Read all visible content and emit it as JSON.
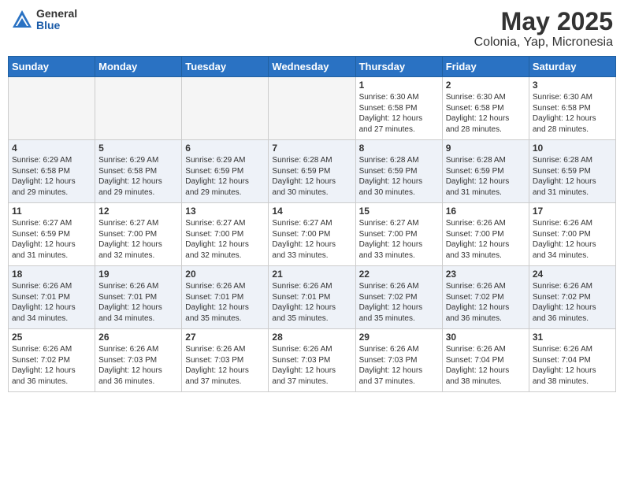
{
  "header": {
    "logo_general": "General",
    "logo_blue": "Blue",
    "month_year": "May 2025",
    "location": "Colonia, Yap, Micronesia"
  },
  "days_of_week": [
    "Sunday",
    "Monday",
    "Tuesday",
    "Wednesday",
    "Thursday",
    "Friday",
    "Saturday"
  ],
  "weeks": [
    [
      {
        "day": "",
        "info": ""
      },
      {
        "day": "",
        "info": ""
      },
      {
        "day": "",
        "info": ""
      },
      {
        "day": "",
        "info": ""
      },
      {
        "day": "1",
        "info": "Sunrise: 6:30 AM\nSunset: 6:58 PM\nDaylight: 12 hours\nand 27 minutes."
      },
      {
        "day": "2",
        "info": "Sunrise: 6:30 AM\nSunset: 6:58 PM\nDaylight: 12 hours\nand 28 minutes."
      },
      {
        "day": "3",
        "info": "Sunrise: 6:30 AM\nSunset: 6:58 PM\nDaylight: 12 hours\nand 28 minutes."
      }
    ],
    [
      {
        "day": "4",
        "info": "Sunrise: 6:29 AM\nSunset: 6:58 PM\nDaylight: 12 hours\nand 29 minutes."
      },
      {
        "day": "5",
        "info": "Sunrise: 6:29 AM\nSunset: 6:58 PM\nDaylight: 12 hours\nand 29 minutes."
      },
      {
        "day": "6",
        "info": "Sunrise: 6:29 AM\nSunset: 6:59 PM\nDaylight: 12 hours\nand 29 minutes."
      },
      {
        "day": "7",
        "info": "Sunrise: 6:28 AM\nSunset: 6:59 PM\nDaylight: 12 hours\nand 30 minutes."
      },
      {
        "day": "8",
        "info": "Sunrise: 6:28 AM\nSunset: 6:59 PM\nDaylight: 12 hours\nand 30 minutes."
      },
      {
        "day": "9",
        "info": "Sunrise: 6:28 AM\nSunset: 6:59 PM\nDaylight: 12 hours\nand 31 minutes."
      },
      {
        "day": "10",
        "info": "Sunrise: 6:28 AM\nSunset: 6:59 PM\nDaylight: 12 hours\nand 31 minutes."
      }
    ],
    [
      {
        "day": "11",
        "info": "Sunrise: 6:27 AM\nSunset: 6:59 PM\nDaylight: 12 hours\nand 31 minutes."
      },
      {
        "day": "12",
        "info": "Sunrise: 6:27 AM\nSunset: 7:00 PM\nDaylight: 12 hours\nand 32 minutes."
      },
      {
        "day": "13",
        "info": "Sunrise: 6:27 AM\nSunset: 7:00 PM\nDaylight: 12 hours\nand 32 minutes."
      },
      {
        "day": "14",
        "info": "Sunrise: 6:27 AM\nSunset: 7:00 PM\nDaylight: 12 hours\nand 33 minutes."
      },
      {
        "day": "15",
        "info": "Sunrise: 6:27 AM\nSunset: 7:00 PM\nDaylight: 12 hours\nand 33 minutes."
      },
      {
        "day": "16",
        "info": "Sunrise: 6:26 AM\nSunset: 7:00 PM\nDaylight: 12 hours\nand 33 minutes."
      },
      {
        "day": "17",
        "info": "Sunrise: 6:26 AM\nSunset: 7:00 PM\nDaylight: 12 hours\nand 34 minutes."
      }
    ],
    [
      {
        "day": "18",
        "info": "Sunrise: 6:26 AM\nSunset: 7:01 PM\nDaylight: 12 hours\nand 34 minutes."
      },
      {
        "day": "19",
        "info": "Sunrise: 6:26 AM\nSunset: 7:01 PM\nDaylight: 12 hours\nand 34 minutes."
      },
      {
        "day": "20",
        "info": "Sunrise: 6:26 AM\nSunset: 7:01 PM\nDaylight: 12 hours\nand 35 minutes."
      },
      {
        "day": "21",
        "info": "Sunrise: 6:26 AM\nSunset: 7:01 PM\nDaylight: 12 hours\nand 35 minutes."
      },
      {
        "day": "22",
        "info": "Sunrise: 6:26 AM\nSunset: 7:02 PM\nDaylight: 12 hours\nand 35 minutes."
      },
      {
        "day": "23",
        "info": "Sunrise: 6:26 AM\nSunset: 7:02 PM\nDaylight: 12 hours\nand 36 minutes."
      },
      {
        "day": "24",
        "info": "Sunrise: 6:26 AM\nSunset: 7:02 PM\nDaylight: 12 hours\nand 36 minutes."
      }
    ],
    [
      {
        "day": "25",
        "info": "Sunrise: 6:26 AM\nSunset: 7:02 PM\nDaylight: 12 hours\nand 36 minutes."
      },
      {
        "day": "26",
        "info": "Sunrise: 6:26 AM\nSunset: 7:03 PM\nDaylight: 12 hours\nand 36 minutes."
      },
      {
        "day": "27",
        "info": "Sunrise: 6:26 AM\nSunset: 7:03 PM\nDaylight: 12 hours\nand 37 minutes."
      },
      {
        "day": "28",
        "info": "Sunrise: 6:26 AM\nSunset: 7:03 PM\nDaylight: 12 hours\nand 37 minutes."
      },
      {
        "day": "29",
        "info": "Sunrise: 6:26 AM\nSunset: 7:03 PM\nDaylight: 12 hours\nand 37 minutes."
      },
      {
        "day": "30",
        "info": "Sunrise: 6:26 AM\nSunset: 7:04 PM\nDaylight: 12 hours\nand 38 minutes."
      },
      {
        "day": "31",
        "info": "Sunrise: 6:26 AM\nSunset: 7:04 PM\nDaylight: 12 hours\nand 38 minutes."
      }
    ]
  ]
}
